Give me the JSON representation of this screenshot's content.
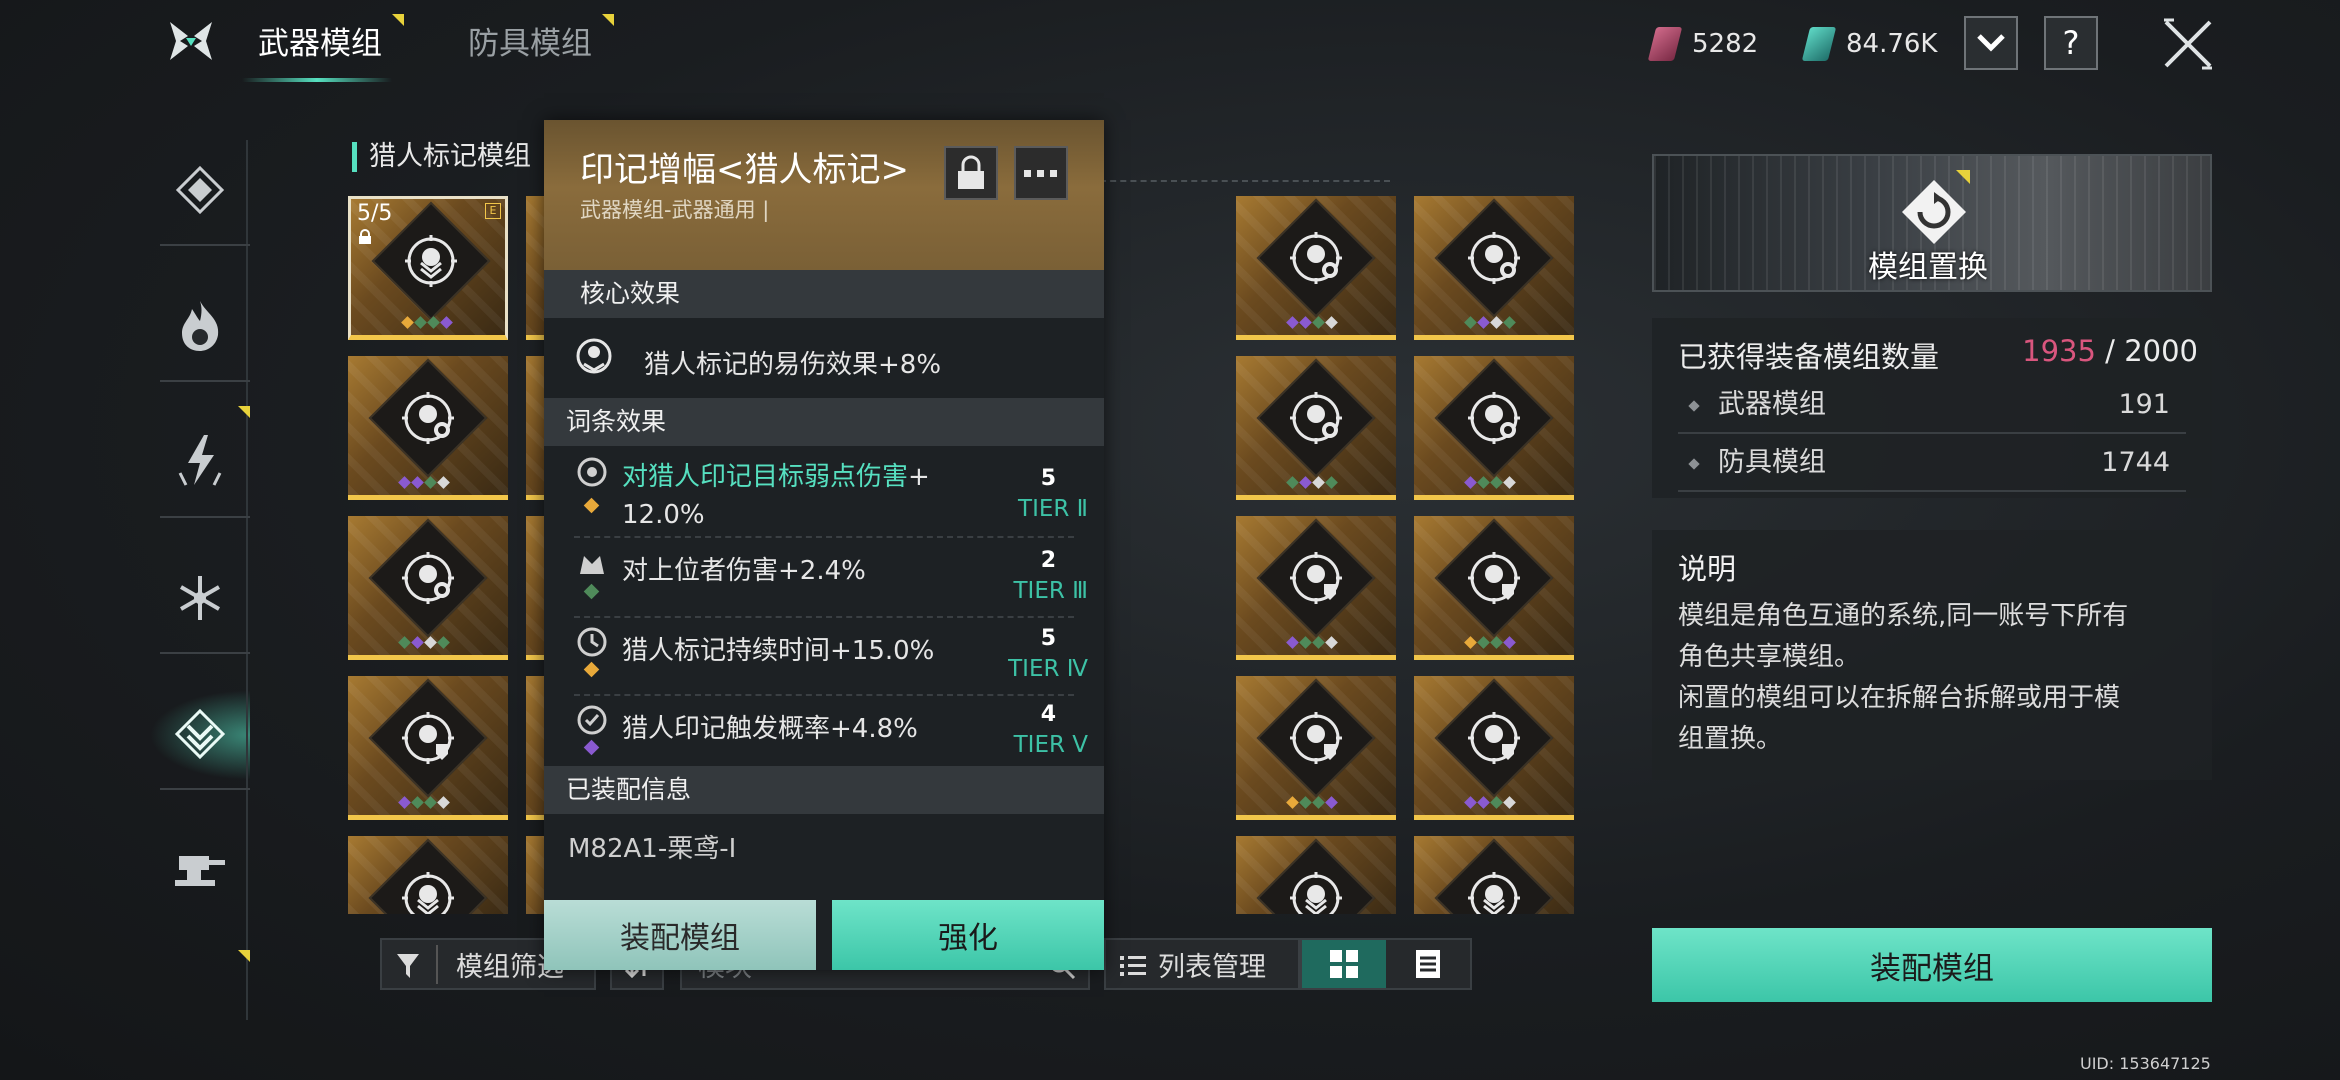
{
  "tabs": [
    {
      "label": "武器模组",
      "active": true
    },
    {
      "label": "防具模组",
      "active": false
    }
  ],
  "currency": {
    "pink": "5282",
    "teal": "84.76K"
  },
  "header_buttons": {
    "help": "?"
  },
  "section_title": "猎人标记模组",
  "selected_card_level": "5/5",
  "selected_card_badge": "E",
  "filter": {
    "filter_label": "模组筛选",
    "search_placeholder": "模块",
    "list_manage": "列表管理"
  },
  "popup": {
    "title": "印记增幅<猎人标记>",
    "subtitle": "武器模组-武器通用 |",
    "core_header": "核心效果",
    "core_effect": "猎人标记的易伤效果+8%",
    "affix_header": "词条效果",
    "affixes": [
      {
        "text_highlight": "对猎人印记目标弱点伤害",
        "text_rest": "+",
        "text_line2": "12.0%",
        "num": "5",
        "tier": "TIER Ⅱ",
        "gem": "#e8a93a"
      },
      {
        "text": "对上位者伤害+2.4%",
        "num": "2",
        "tier": "TIER Ⅲ",
        "gem": "#4f8a5a"
      },
      {
        "text": "猎人标记持续时间+15.0%",
        "num": "5",
        "tier": "TIER Ⅳ",
        "gem": "#e8a93a"
      },
      {
        "text": "猎人印记触发概率+4.8%",
        "num": "4",
        "tier": "TIER Ⅴ",
        "gem": "#8a5ad0"
      }
    ],
    "equipped_header": "已装配信息",
    "equipped_info": "M82A1-栗鸢-I",
    "btn_equip": "装配模组",
    "btn_enhance": "强化"
  },
  "right_panel": {
    "banner_label": "模组置换",
    "owned_label": "已获得装备模组数量",
    "owned_count": "1935",
    "owned_sep": " / ",
    "owned_max": "2000",
    "weapon_label": "武器模组",
    "weapon_count": "191",
    "armor_label": "防具模组",
    "armor_count": "1744",
    "desc_title": "说明",
    "desc_line1": "模组是角色互通的系统,同一账号下所有",
    "desc_line2": "角色共享模组。",
    "desc_line3": "闲置的模组可以在拆解台拆解或用于模",
    "desc_line4": "组置换。",
    "equip_button": "装配模组"
  },
  "uid": "UID: 153647125",
  "colors": {
    "accent": "#56e0c0",
    "gold": "#f2c64a",
    "count": "#d9567e"
  }
}
